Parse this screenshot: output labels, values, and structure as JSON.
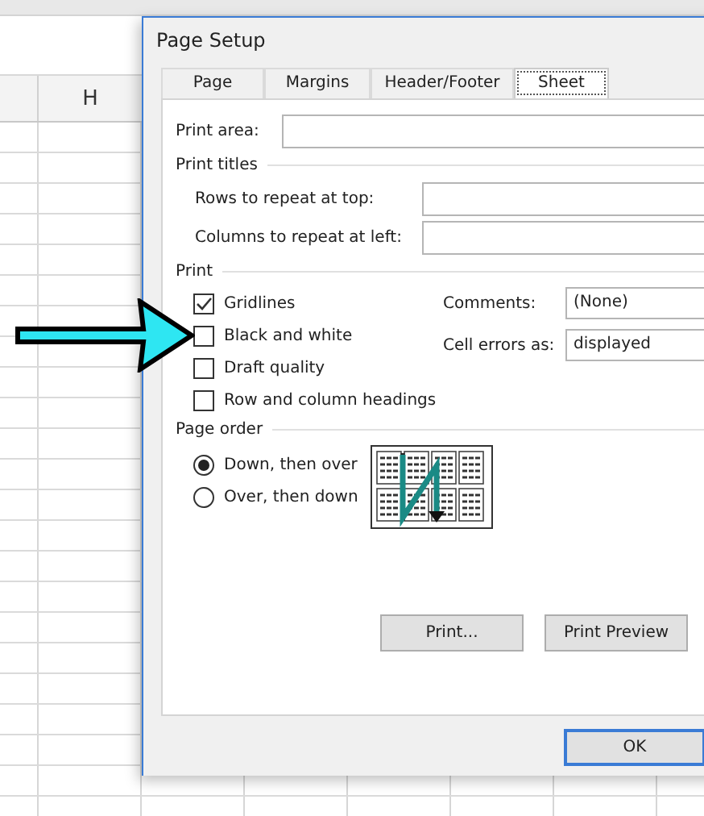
{
  "sheet": {
    "column_header": "H"
  },
  "dialog": {
    "title": "Page Setup",
    "tabs": [
      {
        "label": "Page",
        "selected": false
      },
      {
        "label": "Margins",
        "selected": false
      },
      {
        "label": "Header/Footer",
        "selected": false
      },
      {
        "label": "Sheet",
        "selected": true
      }
    ],
    "print_area": {
      "label": "Print area:"
    },
    "print_titles": {
      "heading": "Print titles",
      "fields": [
        {
          "label": "Rows to repeat at top:"
        },
        {
          "label": "Columns to repeat at left:"
        }
      ]
    },
    "print": {
      "heading": "Print",
      "options": [
        {
          "label": "Gridlines",
          "checked": true
        },
        {
          "label": "Black and white",
          "checked": false
        },
        {
          "label": "Draft quality",
          "checked": false
        },
        {
          "label": "Row and column headings",
          "checked": false
        }
      ],
      "dropdowns": [
        {
          "label": "Comments:",
          "value": "(None)"
        },
        {
          "label": "Cell errors as:",
          "value": "displayed"
        }
      ]
    },
    "page_order": {
      "heading": "Page order",
      "options": [
        {
          "label": "Down, then over",
          "selected": true
        },
        {
          "label": "Over, then down",
          "selected": false
        }
      ]
    },
    "buttons": [
      "Print...",
      "Print Preview"
    ],
    "footer_buttons": [
      "OK"
    ]
  }
}
